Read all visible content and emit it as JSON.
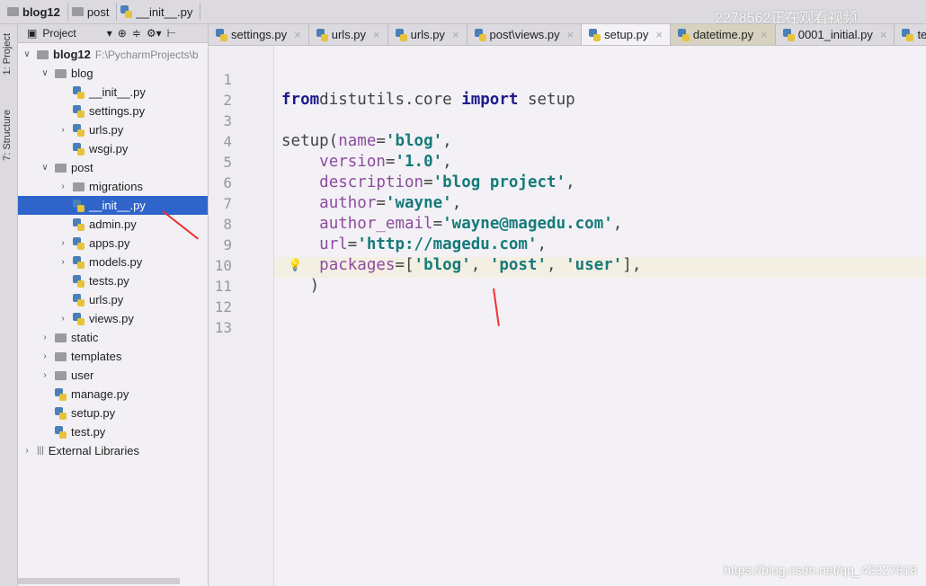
{
  "breadcrumb": [
    "blog12",
    "post",
    "__init__.py"
  ],
  "watermark": "2278562正在观看视频",
  "side_stripe": [
    "1: Project",
    "7: Structure"
  ],
  "project_panel": {
    "title": "Project",
    "root_path": "F:\\PycharmProjects\\b",
    "tree": [
      {
        "label": "blog12",
        "depth": 0,
        "type": "folder",
        "expanded": true,
        "bold": true
      },
      {
        "label": "blog",
        "depth": 1,
        "type": "folder",
        "expanded": true
      },
      {
        "label": "__init__.py",
        "depth": 2,
        "type": "py"
      },
      {
        "label": "settings.py",
        "depth": 2,
        "type": "py"
      },
      {
        "label": "urls.py",
        "depth": 2,
        "type": "py",
        "collapsed": true
      },
      {
        "label": "wsgi.py",
        "depth": 2,
        "type": "py"
      },
      {
        "label": "post",
        "depth": 1,
        "type": "folder",
        "expanded": true
      },
      {
        "label": "migrations",
        "depth": 2,
        "type": "folder",
        "collapsed": true
      },
      {
        "label": "__init__.py",
        "depth": 2,
        "type": "py",
        "selected": true
      },
      {
        "label": "admin.py",
        "depth": 2,
        "type": "py"
      },
      {
        "label": "apps.py",
        "depth": 2,
        "type": "py",
        "collapsed": true
      },
      {
        "label": "models.py",
        "depth": 2,
        "type": "py",
        "collapsed": true
      },
      {
        "label": "tests.py",
        "depth": 2,
        "type": "py"
      },
      {
        "label": "urls.py",
        "depth": 2,
        "type": "py"
      },
      {
        "label": "views.py",
        "depth": 2,
        "type": "py",
        "collapsed": true
      },
      {
        "label": "static",
        "depth": 1,
        "type": "folder",
        "collapsed": true
      },
      {
        "label": "templates",
        "depth": 1,
        "type": "folder",
        "collapsed": true
      },
      {
        "label": "user",
        "depth": 1,
        "type": "folder",
        "collapsed": true
      },
      {
        "label": "manage.py",
        "depth": 1,
        "type": "py"
      },
      {
        "label": "setup.py",
        "depth": 1,
        "type": "py"
      },
      {
        "label": "test.py",
        "depth": 1,
        "type": "py"
      },
      {
        "label": "External Libraries",
        "depth": 0,
        "type": "lib",
        "collapsed": true
      }
    ]
  },
  "tabs": [
    {
      "label": "settings.py"
    },
    {
      "label": "urls.py"
    },
    {
      "label": "urls.py"
    },
    {
      "label": "post\\views.py"
    },
    {
      "label": "setup.py",
      "active": true
    },
    {
      "label": "datetime.py",
      "style": "library"
    },
    {
      "label": "0001_initial.py"
    },
    {
      "label": "te"
    }
  ],
  "editor": {
    "highlighted_line": 10,
    "lines": [
      [],
      [
        [
          "kw",
          "from"
        ],
        [
          "",
          "distutils.core "
        ],
        [
          "kw",
          "import"
        ],
        [
          "",
          " setup"
        ]
      ],
      [],
      [
        [
          "",
          "setup("
        ],
        [
          "pn",
          "name"
        ],
        [
          "",
          "="
        ],
        [
          "st",
          "'blog'"
        ],
        [
          "",
          ","
        ]
      ],
      [
        [
          "",
          "    "
        ],
        [
          "pn",
          "version"
        ],
        [
          "",
          "="
        ],
        [
          "st",
          "'1.0'"
        ],
        [
          "",
          ","
        ]
      ],
      [
        [
          "",
          "    "
        ],
        [
          "pn",
          "description"
        ],
        [
          "",
          "="
        ],
        [
          "st",
          "'blog project'"
        ],
        [
          "",
          ","
        ]
      ],
      [
        [
          "",
          "    "
        ],
        [
          "pn",
          "author"
        ],
        [
          "",
          "="
        ],
        [
          "st",
          "'wayne'"
        ],
        [
          "",
          ","
        ]
      ],
      [
        [
          "",
          "    "
        ],
        [
          "pn",
          "author_email"
        ],
        [
          "",
          "="
        ],
        [
          "st",
          "'wayne@magedu.com'"
        ],
        [
          "",
          ","
        ]
      ],
      [
        [
          "",
          "    "
        ],
        [
          "pn",
          "url"
        ],
        [
          "",
          "="
        ],
        [
          "st",
          "'http://magedu.com'"
        ],
        [
          "",
          ","
        ]
      ],
      [
        [
          "",
          "    "
        ],
        [
          "pn",
          "packages"
        ],
        [
          "",
          "=["
        ],
        [
          "st",
          "'blog'"
        ],
        [
          "",
          ", "
        ],
        [
          "st",
          "'post'"
        ],
        [
          "",
          ", "
        ],
        [
          "st",
          "'user'"
        ],
        [
          "",
          "],"
        ]
      ],
      [
        [
          "",
          "   )"
        ]
      ],
      [],
      []
    ]
  },
  "csdn_watermark": "https://blog.csdn.net/qq_42227818",
  "colors": {
    "selection": "#2f65ca",
    "keyword": "#1d1a8c",
    "param": "#8d4ba0",
    "string": "#167a7a",
    "annotation_arrow": "#f03030"
  }
}
